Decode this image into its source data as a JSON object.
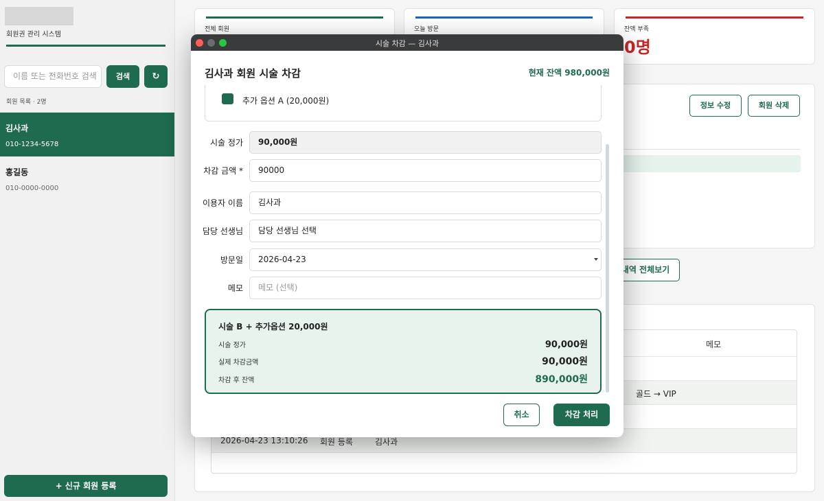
{
  "sidebar": {
    "app_title": "회원권 관리 시스템",
    "search_placeholder": "이름 또는 전화번호 검색",
    "search_label": "검색",
    "refresh_icon": "↻",
    "list_label": "회원 목록 · 2명",
    "members": [
      {
        "name": "김사과",
        "phone": "010-1234-5678"
      },
      {
        "name": "홍길동",
        "phone": "010-0000-0000"
      }
    ],
    "new_member_label": "+ 신규 회원 등록"
  },
  "stats": [
    {
      "label": "전체 회원",
      "color": "#1e6b4f"
    },
    {
      "label": "오늘 방문",
      "color": "#1565c0"
    },
    {
      "label": "잔액 부족",
      "value": "0명",
      "color": "#c62828"
    }
  ],
  "detail": {
    "edit_label": "정보 수정",
    "delete_label": "회원 삭제",
    "history_label": "내역 전체보기"
  },
  "history_table": {
    "memo_header": "메모",
    "rows": [
      {
        "memo": ""
      },
      {
        "memo": "골드 → VIP"
      },
      {
        "memo": ""
      },
      {
        "datetime": "2026-04-23 13:10:26",
        "type": "회원 등록",
        "name": "김사과",
        "memo": ""
      }
    ]
  },
  "modal": {
    "window_title": "시술 차감 — 김사과",
    "heading": "김사과 회원 시술 차감",
    "balance_label": "현재 잔액",
    "balance_value": "980,000원",
    "option_label": "추가 옵션 A (20,000원)",
    "option_checked": true,
    "fields": {
      "price_label": "시술 정가",
      "price_value": "90,000원",
      "deduct_label": "차감 금액 *",
      "deduct_value": "90000",
      "user_label": "이용자 이름",
      "user_value": "김사과",
      "teacher_label": "담당 선생님",
      "teacher_value": "담당 선생님 선택",
      "date_label": "방문일",
      "date_value": "2026-04-23",
      "memo_label": "메모",
      "memo_placeholder": "메모 (선택)"
    },
    "summary": {
      "title": "시술 B + 추가옵션 20,000원",
      "price_label": "시술 정가",
      "price_value": "90,000원",
      "actual_label": "실제 차감금액",
      "actual_value": "90,000원",
      "after_label": "차감 후 잔액",
      "after_value": "890,000원"
    },
    "cancel_label": "취소",
    "submit_label": "차감 처리"
  },
  "colors": {
    "primary": "#1e6b4f",
    "danger": "#c62828",
    "blue": "#1565c0"
  }
}
